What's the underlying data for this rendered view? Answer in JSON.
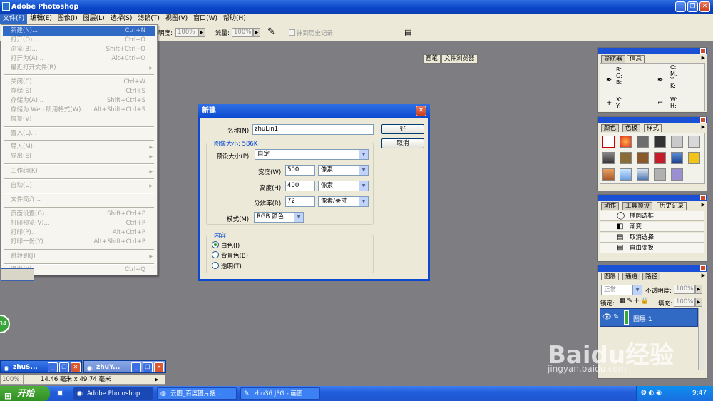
{
  "app": {
    "title": "Adobe Photoshop"
  },
  "menubar": [
    "文件(F)",
    "编辑(E)",
    "图像(I)",
    "图层(L)",
    "选择(S)",
    "滤镜(T)",
    "视图(V)",
    "窗口(W)",
    "帮助(H)"
  ],
  "options": {
    "opacity_label": "明度:",
    "opacity_value": "100%",
    "flow_label": "流量:",
    "flow_value": "100%",
    "history_checkbox": "抹到历史记录",
    "dock_tabs": [
      "画笔",
      "文件浏览器"
    ]
  },
  "file_menu": [
    {
      "label": "新建(N)...",
      "shortcut": "Ctrl+N"
    },
    {
      "label": "打开(O)...",
      "shortcut": "Ctrl+O"
    },
    {
      "label": "浏览(B)...",
      "shortcut": "Shift+Ctrl+O"
    },
    {
      "label": "打开为(A)...",
      "shortcut": "Alt+Ctrl+O"
    },
    {
      "label": "最近打开文件(R)",
      "shortcut": ""
    },
    {
      "label": "关闭(C)",
      "shortcut": "Ctrl+W"
    },
    {
      "label": "存储(S)",
      "shortcut": "Ctrl+S"
    },
    {
      "label": "存储为(A)...",
      "shortcut": "Shift+Ctrl+S"
    },
    {
      "label": "存储为 Web 所用格式(W)...",
      "shortcut": "Alt+Shift+Ctrl+S"
    },
    {
      "label": "恢复(V)",
      "shortcut": ""
    },
    {
      "label": "置入(L)...",
      "shortcut": ""
    },
    {
      "label": "导入(M)",
      "shortcut": ""
    },
    {
      "label": "导出(E)",
      "shortcut": ""
    },
    {
      "label": "工作组(K)",
      "shortcut": ""
    },
    {
      "label": "自动(U)",
      "shortcut": ""
    },
    {
      "label": "文件简介...",
      "shortcut": ""
    },
    {
      "label": "页面设置(G)...",
      "shortcut": "Shift+Ctrl+P"
    },
    {
      "label": "打印预览(V)...",
      "shortcut": "Ctrl+P"
    },
    {
      "label": "打印(P)...",
      "shortcut": "Alt+Ctrl+P"
    },
    {
      "label": "打印一份(Y)",
      "shortcut": "Alt+Shift+Ctrl+P"
    },
    {
      "label": "跳转到(J)",
      "shortcut": ""
    },
    {
      "label": "退出(X)",
      "shortcut": "Ctrl+Q"
    }
  ],
  "dialog": {
    "title": "新建",
    "name_label": "名称(N):",
    "name_value": "zhuLin1",
    "ok": "好",
    "cancel": "取消",
    "image_size_label": "图像大小: 586K",
    "preset_label": "预设大小(P):",
    "preset_value": "自定",
    "width_label": "宽度(W):",
    "width_value": "500",
    "width_unit": "像素",
    "height_label": "高度(H):",
    "height_value": "400",
    "height_unit": "像素",
    "resolution_label": "分辨率(R):",
    "resolution_value": "72",
    "resolution_unit": "像素/英寸",
    "mode_label": "模式(M):",
    "mode_value": "RGB 颜色",
    "contents_label": "内容",
    "contents": [
      "白色(I)",
      "背景色(B)",
      "透明(T)"
    ]
  },
  "palettes": {
    "navigator_tabs": [
      "导航器",
      "信息"
    ],
    "info": {
      "rgb": "R:\nG:\nB:",
      "cmyk": "C:\nM:\nY:\nK:",
      "xy": "X:\nY:",
      "wh": "W:\nH:"
    },
    "color_tabs": [
      "颜色",
      "色板",
      "样式"
    ],
    "history_tabs": [
      "动作",
      "工具预设",
      "历史记录"
    ],
    "history_items": [
      "椭圆选框",
      "渐变",
      "取消选择",
      "自由变换"
    ],
    "layers_tabs": [
      "图层",
      "通道",
      "路径"
    ],
    "blend_mode": "正常",
    "layer_opacity_label": "不透明度:",
    "layer_opacity_value": "100%",
    "lock_label": "锁定:",
    "fill_label": "填充:",
    "fill_value": "100%",
    "layer_name": "图层 1"
  },
  "docs": {
    "win1": "zhuS...",
    "win2": "zhuY...",
    "zoom": "100%",
    "doc_size": "14.46 毫米 x 49.74 毫米"
  },
  "taskbar": {
    "start": "开始",
    "tasks": [
      "Adobe Photoshop",
      "云图_百度图片搜...",
      "zhu36.JPG - 画图"
    ],
    "clock": "9:47",
    "badge": "34"
  },
  "watermark": {
    "line1": "Baidu经验",
    "line2": "jingyan.baidu.com"
  },
  "colors": {
    "accent": "#316ac5",
    "titlebar": "#0a45c8",
    "canvas": "#7e7d82"
  }
}
